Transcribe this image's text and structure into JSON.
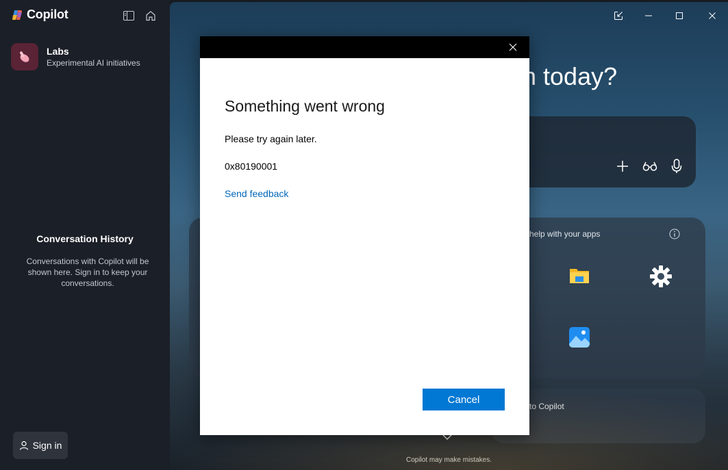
{
  "sidebar": {
    "brand": "Copilot",
    "labs": {
      "title": "Labs",
      "subtitle": "Experimental AI initiatives"
    },
    "history": {
      "title": "Conversation History",
      "text": "Conversations with Copilot will be shown here. Sign in to keep your conversations."
    },
    "sign_in": "Sign in"
  },
  "main": {
    "greeting_partial": "h today?",
    "apps_label": "help with your apps",
    "talk_label": "to Copilot",
    "disclaimer": "Copilot may make mistakes."
  },
  "dialog": {
    "title": "Something went wrong",
    "message": "Please try again later.",
    "code": "0x80190001",
    "link": "Send feedback",
    "cancel": "Cancel"
  },
  "colors": {
    "accent": "#0078d4",
    "link": "#0067b8",
    "sidebar_bg": "#1b1f27",
    "labs_icon_bg": "#5a2336"
  }
}
